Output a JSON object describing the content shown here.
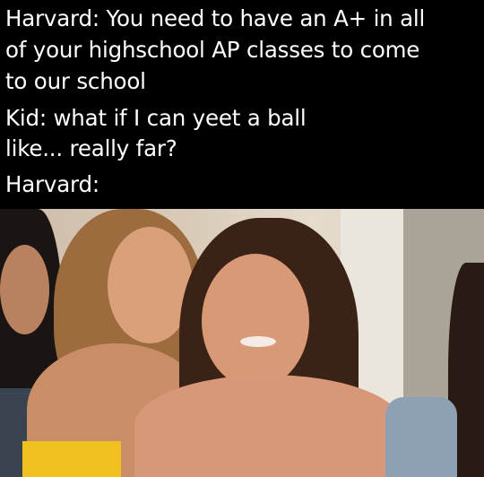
{
  "caption": {
    "lines": [
      "Harvard: You need to have an A+ in all",
      "of your highschool AP classes to come",
      "to our school",
      "Kid: what if I can yeet a ball",
      "like... really far?",
      "Harvard:"
    ]
  },
  "photo": {
    "description_icon": "photo-of-smirking-girls"
  }
}
